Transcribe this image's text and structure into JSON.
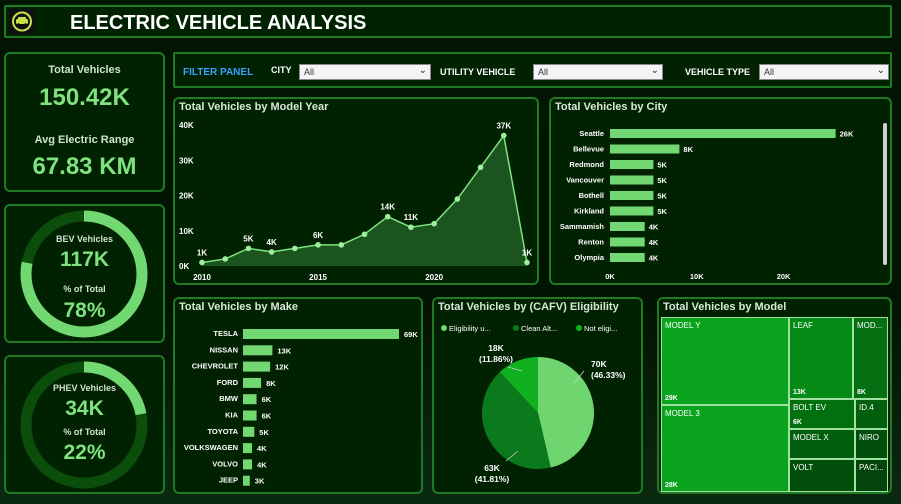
{
  "header": {
    "title": "ELECTRIC VEHICLE ANALYSIS"
  },
  "kpis": {
    "total_vehicles_label": "Total Vehicles",
    "total_vehicles_value": "150.42K",
    "avg_range_label": "Avg Electric Range",
    "avg_range_value": "67.83 KM"
  },
  "bev": {
    "label": "BEV Vehicles",
    "value": "117K",
    "pct_label": "% of Total",
    "pct_value": "78%",
    "fraction": 0.78
  },
  "phev": {
    "label": "PHEV Vehicles",
    "value": "34K",
    "pct_label": "% of Total",
    "pct_value": "22%",
    "fraction": 0.22
  },
  "filters": {
    "panel_label": "FILTER PANEL",
    "city_label": "CITY",
    "city_value": "All",
    "utility_label": "UTILITY VEHICLE",
    "utility_value": "All",
    "type_label": "VEHICLE TYPE",
    "type_value": "All"
  },
  "colors": {
    "accent": "#7ee37e",
    "border": "#1f7a23",
    "panel": "#012201",
    "bar": "#72d872"
  },
  "chart_data": [
    {
      "type": "area",
      "title": "Total Vehicles by Model Year",
      "x": [
        2010,
        2011,
        2012,
        2013,
        2014,
        2015,
        2016,
        2017,
        2018,
        2019,
        2020,
        2021,
        2022,
        2023,
        2024
      ],
      "y": [
        1000,
        2000,
        5000,
        4000,
        5000,
        6000,
        6000,
        9000,
        14000,
        11000,
        12000,
        19000,
        28000,
        37000,
        1000
      ],
      "data_labels": {
        "0": "1K",
        "2": "5K",
        "3": "4K",
        "5": "6K",
        "8": "14K",
        "9": "11K",
        "13": "37K",
        "14": "1K"
      },
      "xticks": [
        "2010",
        "2015",
        "2020"
      ],
      "yticks": [
        "0K",
        "10K",
        "20K",
        "30K",
        "40K"
      ],
      "ylim": [
        0,
        40000
      ],
      "xlim": [
        2010,
        2024
      ]
    },
    {
      "type": "bar",
      "orientation": "horizontal",
      "title": "Total Vehicles by City",
      "categories": [
        "Seattle",
        "Bellevue",
        "Redmond",
        "Vancouver",
        "Bothell",
        "Kirkland",
        "Sammamish",
        "Renton",
        "Olympia"
      ],
      "values": [
        26000,
        8000,
        5000,
        5000,
        5000,
        5000,
        4000,
        4000,
        4000
      ],
      "labels": [
        "26K",
        "8K",
        "5K",
        "5K",
        "5K",
        "5K",
        "4K",
        "4K",
        "4K"
      ],
      "xticks": [
        "0K",
        "10K",
        "20K"
      ],
      "xlim": [
        0,
        28000
      ]
    },
    {
      "type": "bar",
      "orientation": "horizontal",
      "title": "Total Vehicles by Make",
      "categories": [
        "TESLA",
        "NISSAN",
        "CHEVROLET",
        "FORD",
        "BMW",
        "KIA",
        "TOYOTA",
        "VOLKSWAGEN",
        "VOLVO",
        "JEEP"
      ],
      "values": [
        69000,
        13000,
        12000,
        8000,
        6000,
        6000,
        5000,
        4000,
        4000,
        3000
      ],
      "labels": [
        "69K",
        "13K",
        "12K",
        "8K",
        "6K",
        "6K",
        "5K",
        "4K",
        "4K",
        "3K"
      ],
      "xlim": [
        0,
        69000
      ]
    },
    {
      "type": "pie",
      "title": "Total Vehicles by (CAFV) Eligibility",
      "legend": [
        "Eligibility u...",
        "Clean Alt...",
        "Not eligi..."
      ],
      "slices": [
        {
          "name": "Eligibility u...",
          "value": 70000,
          "label": "70K",
          "pct": "(46.33%)",
          "color": "#6fd66f"
        },
        {
          "name": "Clean Alt...",
          "value": 63000,
          "label": "63K",
          "pct": "(41.81%)",
          "color": "#0a7a1c"
        },
        {
          "name": "Not eligi...",
          "value": 18000,
          "label": "18K",
          "pct": "(11.86%)",
          "color": "#10b020"
        }
      ]
    },
    {
      "type": "treemap",
      "title": "Total Vehicles by Model",
      "items": [
        {
          "name": "MODEL Y",
          "value": "29K"
        },
        {
          "name": "MODEL 3",
          "value": "28K"
        },
        {
          "name": "LEAF",
          "value": "13K"
        },
        {
          "name": "MOD...",
          "value": "8K"
        },
        {
          "name": "BOLT EV",
          "value": "6K"
        },
        {
          "name": "ID.4",
          "value": ""
        },
        {
          "name": "MODEL X",
          "value": ""
        },
        {
          "name": "NIRO",
          "value": ""
        },
        {
          "name": "VOLT",
          "value": ""
        },
        {
          "name": "PACI...",
          "value": ""
        }
      ]
    }
  ]
}
